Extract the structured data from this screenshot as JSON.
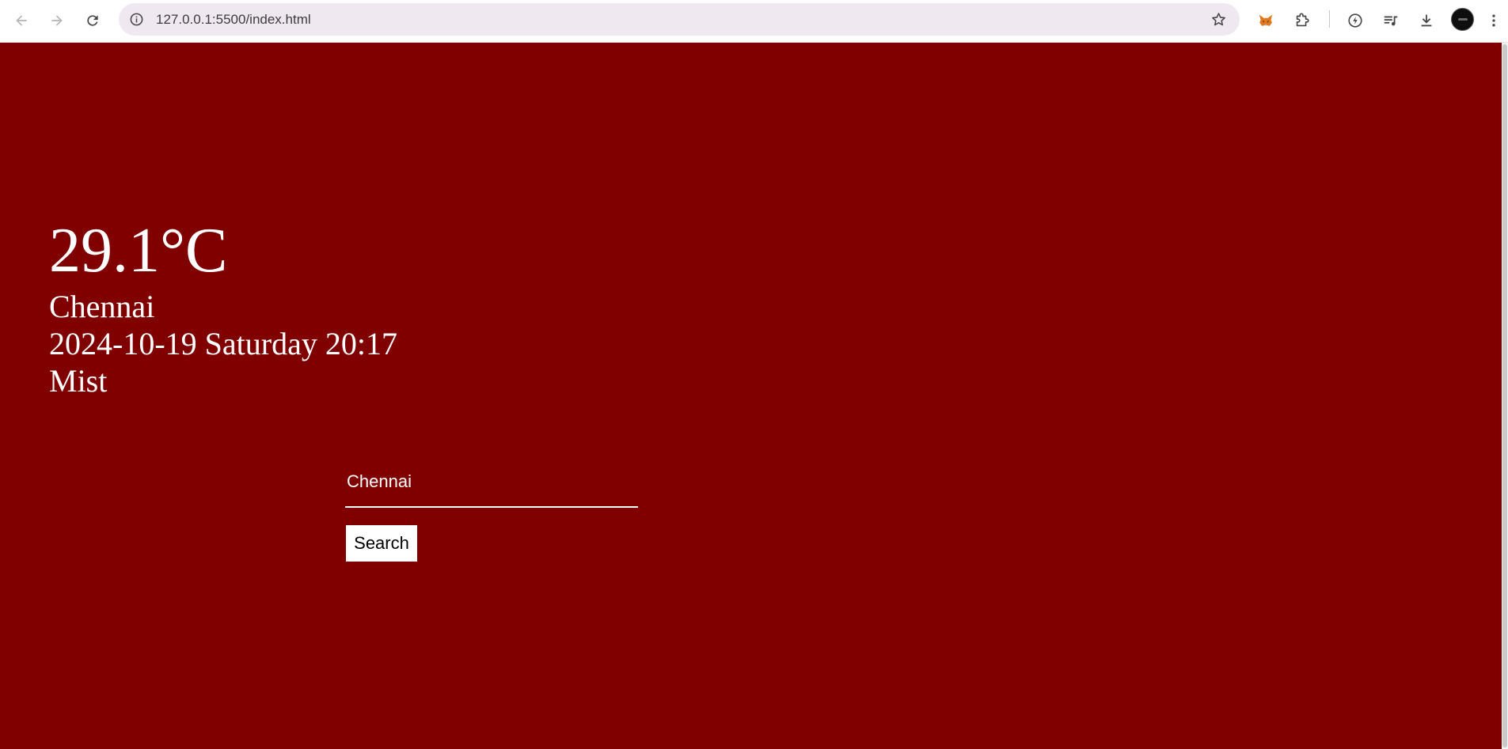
{
  "browser": {
    "url": "127.0.0.1:5500/index.html"
  },
  "weather": {
    "temperature": "29.1°C",
    "city": "Chennai",
    "datetime": "2024-10-19 Saturday 20:17",
    "condition": "Mist"
  },
  "search": {
    "value": "Chennai",
    "button_label": "Search"
  },
  "colors": {
    "page_background": "#800000",
    "text": "#ffffff"
  }
}
